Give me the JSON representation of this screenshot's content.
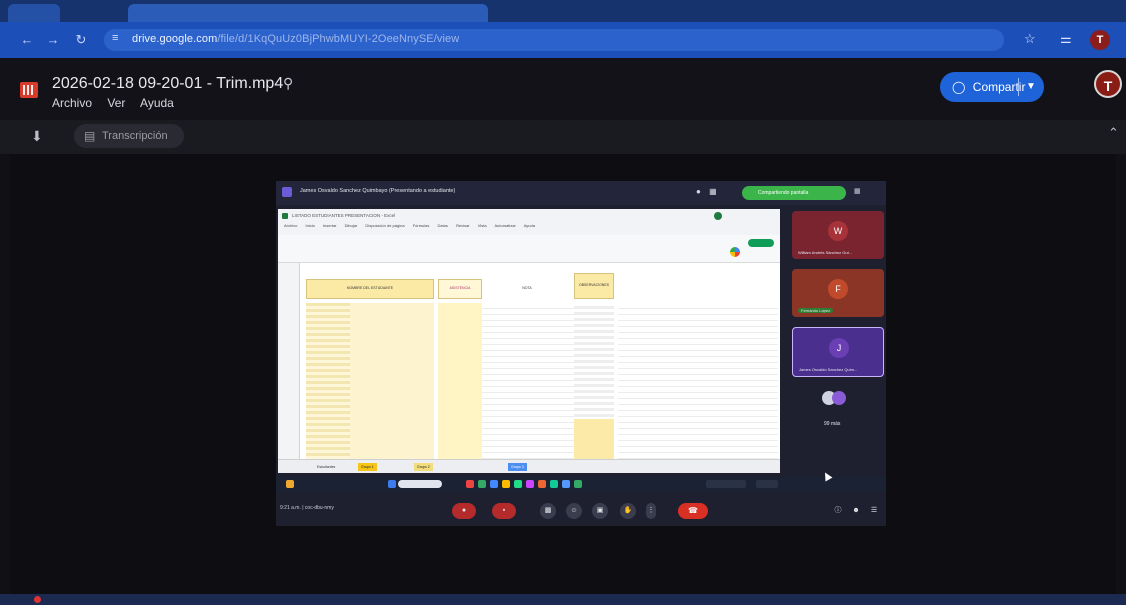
{
  "browser": {
    "url_host": "drive.google.com",
    "url_path": "/file/d/1KqQuUz0BjPhwbMUYI-2OeeNnySE/view",
    "colors": {
      "tabstrip": "#16336e",
      "addressbar": "#1d4fb8"
    },
    "icons": {
      "back": "arrow-left-icon",
      "forward": "arrow-right-icon",
      "reload": "reload-icon",
      "site_info": "tune-icon",
      "bookmark": "star-icon",
      "extensions": "puzzle-icon"
    },
    "profile_initial": "T"
  },
  "viewer": {
    "file_title": "2026-02-18 09-20-01 - Trim.mp4",
    "menu": [
      "Archivo",
      "Ver",
      "Ayuda"
    ],
    "share_label": "Compartir",
    "user_initial": "T",
    "transcript_label": "Transcripción",
    "colors": {
      "share": "#1f63d9",
      "avatar": "#8a1c16",
      "file_icon": "#d93b2b"
    }
  },
  "meeting": {
    "presenter_banner": "James Osvaldo Sanchez Quimbayo (Presentando a estudiante)",
    "join_label": "Compartiendo pantalla",
    "spreadsheet": {
      "title": "LISTADO ESTUDIANTES PRESENTACION - Excel",
      "menu": [
        "Archivo",
        "Inicio",
        "Insertar",
        "Dibujar",
        "Disposición de página",
        "Fórmulas",
        "Datos",
        "Revisar",
        "Vista",
        "Automatizar",
        "Ayuda"
      ],
      "headers": [
        "NOMBRE DEL ESTUDIANTE",
        "ASISTENCIA",
        "NOTA",
        "OBSERVACIONES"
      ],
      "tabs": [
        "Estudiantes",
        "Grupo 1",
        "Grupo 2",
        "Grupo 3"
      ]
    },
    "participants": [
      {
        "initial": "W",
        "name": "William Andrés Sánchez Gut...",
        "color": "#a8323a"
      },
      {
        "initial": "F",
        "name": "Fernando López",
        "color": "#c24a2c"
      },
      {
        "initial": "J",
        "name": "James Osvaldo Sanchez Quim...",
        "color": "#6a3fb3"
      },
      {
        "initial": "",
        "name": "99 más",
        "color": "#333645"
      }
    ],
    "clock": "9:21 a.m. | coc-dbu-nmy",
    "controls": [
      "mic-icon",
      "camera-icon",
      "captions-icon",
      "emoji-icon",
      "present-icon",
      "raise-hand-icon",
      "more-icon",
      "hangup-icon"
    ]
  }
}
